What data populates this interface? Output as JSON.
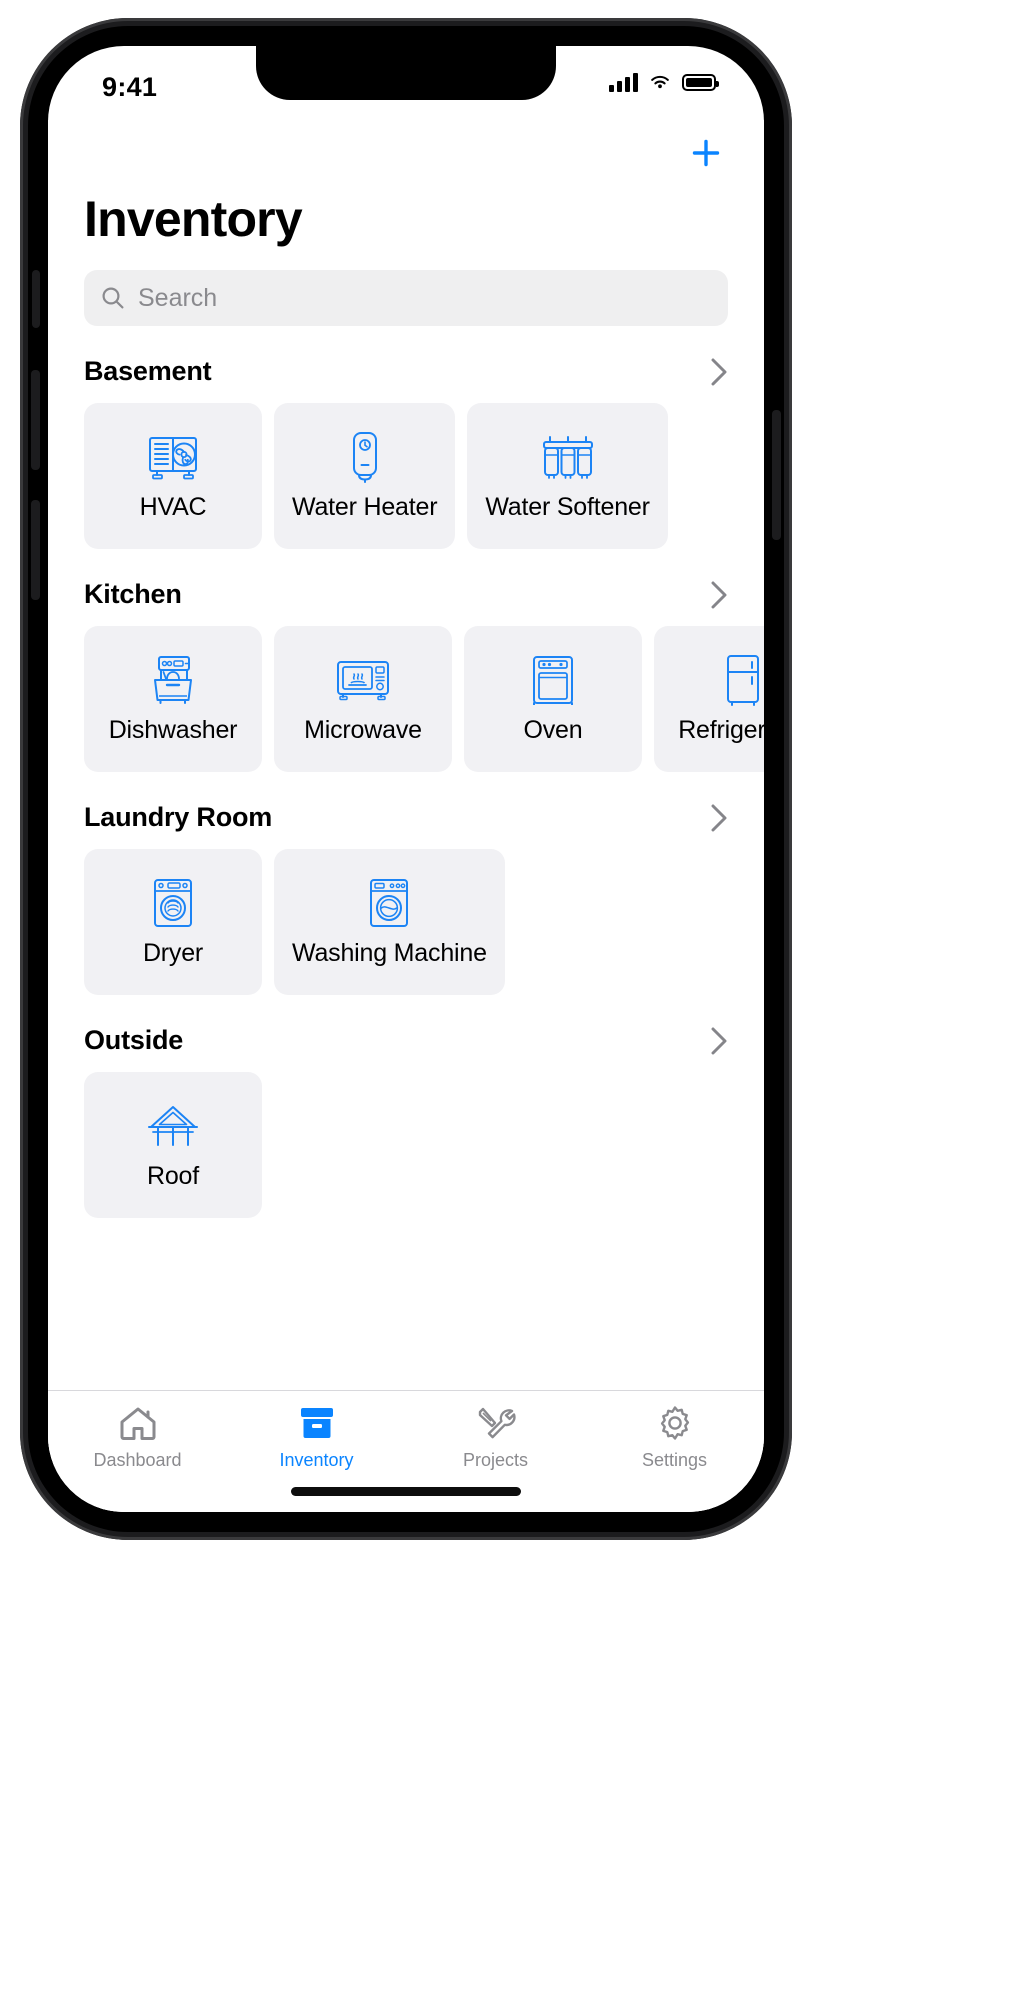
{
  "status_bar": {
    "time": "9:41",
    "cellular_icon": "signal-bars-icon",
    "wifi_icon": "wifi-icon",
    "battery_icon": "battery-full-icon"
  },
  "header": {
    "title": "Inventory",
    "add_button_icon": "plus-icon",
    "add_button_label": "+"
  },
  "search": {
    "placeholder": "Search",
    "value": "",
    "icon": "search-icon"
  },
  "theme": {
    "accent": "#0a84ff",
    "icon_blue": "#1c84f5",
    "card_bg": "#f1f1f4",
    "search_bg": "#efeff0",
    "inactive_gray": "#8a8a8e"
  },
  "sections": [
    {
      "title": "Basement",
      "chevron_icon": "chevron-right-icon",
      "items": [
        {
          "label": "HVAC",
          "icon": "hvac-icon"
        },
        {
          "label": "Water Heater",
          "icon": "water-heater-icon"
        },
        {
          "label": "Water Softener",
          "icon": "water-softener-icon"
        }
      ]
    },
    {
      "title": "Kitchen",
      "chevron_icon": "chevron-right-icon",
      "items": [
        {
          "label": "Dishwasher",
          "icon": "dishwasher-icon"
        },
        {
          "label": "Microwave",
          "icon": "microwave-icon"
        },
        {
          "label": "Oven",
          "icon": "oven-icon"
        },
        {
          "label": "Refrigerator",
          "icon": "refrigerator-icon"
        }
      ]
    },
    {
      "title": "Laundry Room",
      "chevron_icon": "chevron-right-icon",
      "items": [
        {
          "label": "Dryer",
          "icon": "dryer-icon"
        },
        {
          "label": "Washing Machine",
          "icon": "washing-machine-icon"
        }
      ]
    },
    {
      "title": "Outside",
      "chevron_icon": "chevron-right-icon",
      "items": [
        {
          "label": "Roof",
          "icon": "roof-icon"
        }
      ]
    }
  ],
  "tabbar": {
    "tabs": [
      {
        "label": "Dashboard",
        "icon": "house-icon",
        "active": false
      },
      {
        "label": "Inventory",
        "icon": "archive-box-icon",
        "active": true
      },
      {
        "label": "Projects",
        "icon": "tools-icon",
        "active": false
      },
      {
        "label": "Settings",
        "icon": "gear-icon",
        "active": false
      }
    ]
  }
}
